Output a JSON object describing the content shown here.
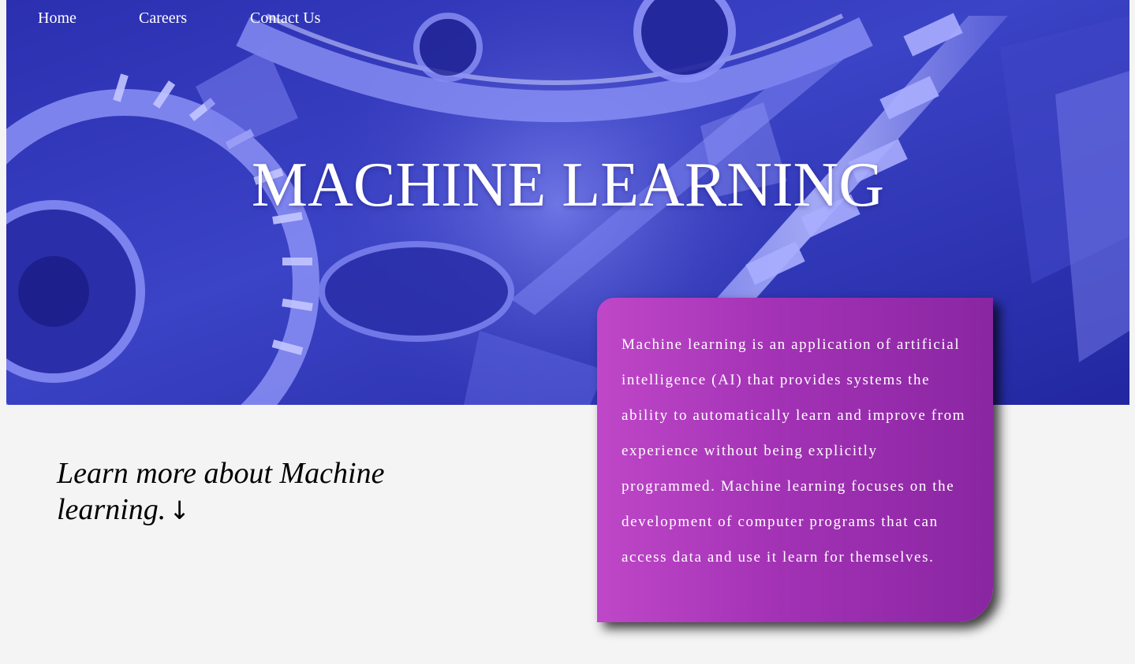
{
  "nav": {
    "items": [
      {
        "label": "Home"
      },
      {
        "label": "Careers"
      },
      {
        "label": "Contact Us"
      }
    ]
  },
  "hero": {
    "title": "MACHINE LEARNING"
  },
  "cta": {
    "text": "Learn more about Machine learning.",
    "arrow": "↓"
  },
  "info_card": {
    "text": "Machine learning is an application of artificial intelligence (AI) that provides systems the ability to automatically learn and improve from experience without being explicitly programmed. Machine learning focuses on the development of computer programs that can access data and use it learn for themselves."
  },
  "colors": {
    "hero_dark": "#23259a",
    "hero_light": "#8f93f2",
    "card_start": "#bf47c8",
    "card_end": "#8a26a2",
    "page_background": "#f4f4f4"
  },
  "icons": {
    "cta_arrow": "down-arrow-icon"
  }
}
